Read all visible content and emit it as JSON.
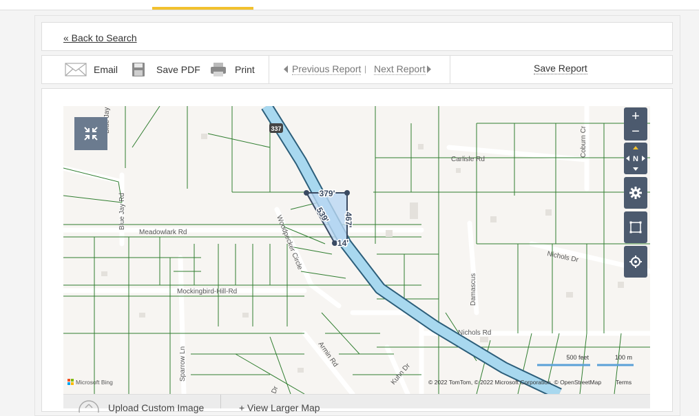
{
  "nav": {
    "back_label": "« Back to Search"
  },
  "toolbar": {
    "email_label": "Email",
    "save_pdf_label": "Save PDF",
    "print_label": "Print",
    "prev_label": "Previous Report",
    "next_label": "Next Report",
    "save_report_label": "Save Report"
  },
  "map": {
    "controls": {
      "zoom_in": "+",
      "zoom_out": "−",
      "compass": "N"
    },
    "route_shield": "337",
    "streets": [
      "Blue Jay Rd",
      "Blue Jay",
      "Meadowlark Rd",
      "Mockingbird-Hill-Rd",
      "Sparrow Ln",
      "Woodpecker Circle",
      "Armin Rd",
      "Kuhn Dr",
      "Carlisle Rd",
      "Coburn Cr",
      "Nichols Dr",
      "Nichols Rd",
      "Damascus",
      "Dr"
    ],
    "measurements": [
      "379'",
      "467'",
      "539'",
      "14'"
    ],
    "scale": {
      "feet": "500 feet",
      "meters": "100 m"
    },
    "attribution": "© 2022 TomTom, © 2022 Microsoft Corporation, © OpenStreetMap",
    "terms": "Terms",
    "bing": "Microsoft Bing"
  },
  "footer": {
    "upload_label": "Upload Custom Image",
    "larger_map_label": "View Larger Map"
  }
}
